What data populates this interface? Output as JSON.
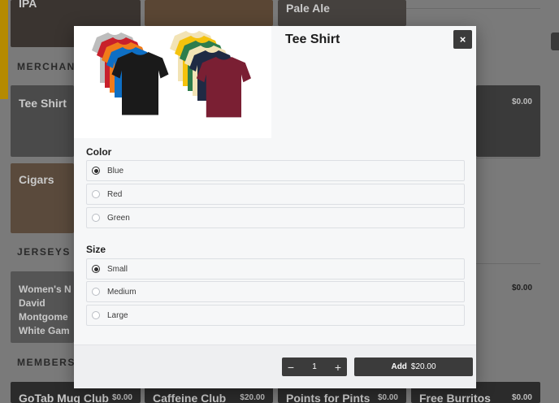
{
  "background": {
    "top_tiles": [
      {
        "name": "IPA"
      },
      {
        "name": ""
      },
      {
        "name": "Pale Ale"
      }
    ],
    "sections": {
      "merchandise": "MERCHAND",
      "jerseys": "JERSEYS",
      "memberships": "MEMBERSH"
    },
    "merch_tiles": [
      {
        "name": "Tee Shirt"
      },
      {
        "name": "Cigars"
      },
      {
        "name": "",
        "price": "$0.00"
      }
    ],
    "jersey_tile": {
      "name": "Women's N David Montgome White Gam"
    },
    "jersey_row_price": "$0.00",
    "membership_tiles": [
      {
        "name": "GoTab Mug Club",
        "price": "$0.00"
      },
      {
        "name": "Caffeine Club",
        "price": "$20.00"
      },
      {
        "name": "Points for Pints",
        "price": "$0.00"
      },
      {
        "name": "Free Burritos",
        "price": "$0.00"
      }
    ]
  },
  "modal": {
    "title": "Tee Shirt",
    "close_label": "×",
    "image_icon": "tshirt-stack-image",
    "color_group": {
      "label": "Color",
      "options": [
        "Blue",
        "Red",
        "Green"
      ],
      "selected": "Blue"
    },
    "size_group": {
      "label": "Size",
      "options": [
        "Small",
        "Medium",
        "Large"
      ],
      "selected": "Small"
    },
    "footer": {
      "decrement_label": "−",
      "quantity": "1",
      "increment_label": "+",
      "add_label": "Add",
      "add_price": "$20.00"
    }
  },
  "colors": {
    "accent_dark": "#3b3b3b",
    "modal_bg": "#f6f7f8",
    "shirt_colors": [
      "#1a1a1a",
      "#0e6fc4",
      "#f07b1a",
      "#c8202b",
      "#bdbdbd",
      "#7a1f33",
      "#1f2a44",
      "#f2e3b5",
      "#2e7d4c",
      "#f4c20d"
    ]
  }
}
